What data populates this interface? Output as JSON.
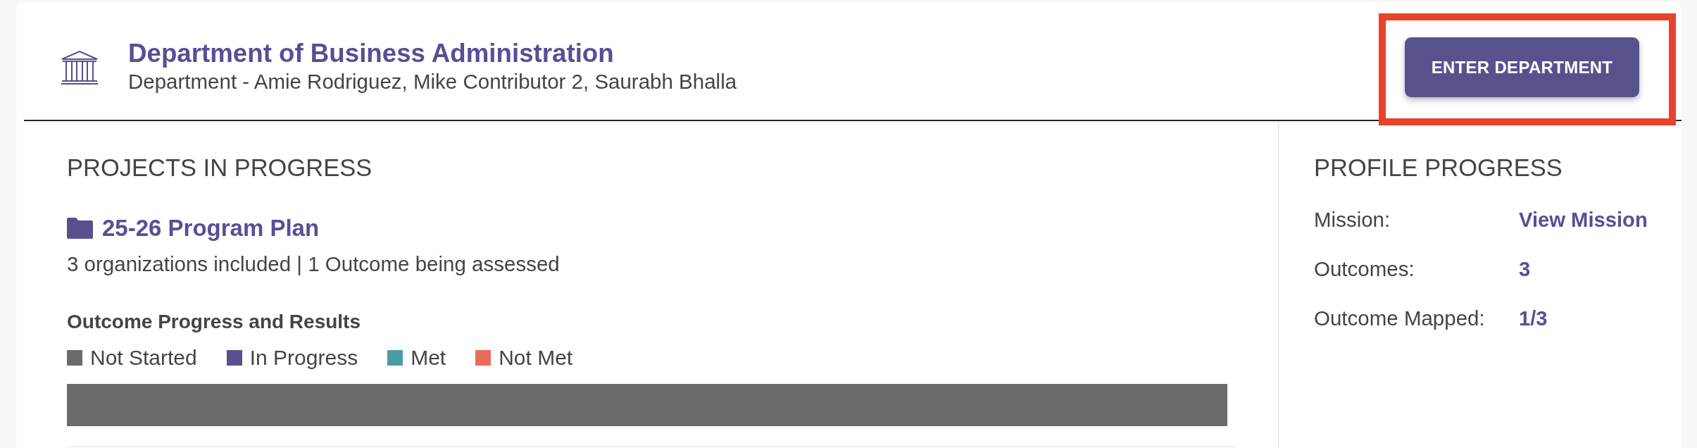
{
  "department": {
    "title": "Department of Business Administration",
    "subtitle": "Department - Amie Rodriguez, Mike Contributor 2, Saurabh Bhalla",
    "button": {
      "label": "ENTER DEPARTMENT",
      "highlighted": true
    }
  },
  "projects": {
    "heading": "PROJECTS IN PROGRESS",
    "items": [
      {
        "title": "25-26 Program Plan",
        "summary": "3 organizations included | 1 Outcome being assessed",
        "results_heading": "Outcome Progress and Results",
        "legend": [
          {
            "label": "Not Started",
            "color": "#6b6b6b"
          },
          {
            "label": "In Progress",
            "color": "#56508f"
          },
          {
            "label": "Met",
            "color": "#4a9ca4"
          },
          {
            "label": "Not Met",
            "color": "#eb6b5a"
          }
        ],
        "progress_bar": {
          "segments": [
            {
              "level": 1,
              "color": "#6b6b6b"
            }
          ]
        }
      }
    ]
  },
  "profile_progress": {
    "heading": "PROFILE PROGRESS",
    "rows": [
      {
        "label": "Mission:",
        "value": "View Mission"
      },
      {
        "label": "Outcomes:",
        "value": "3"
      },
      {
        "label": "Outcome Mapped:",
        "value": "1/3"
      }
    ]
  }
}
